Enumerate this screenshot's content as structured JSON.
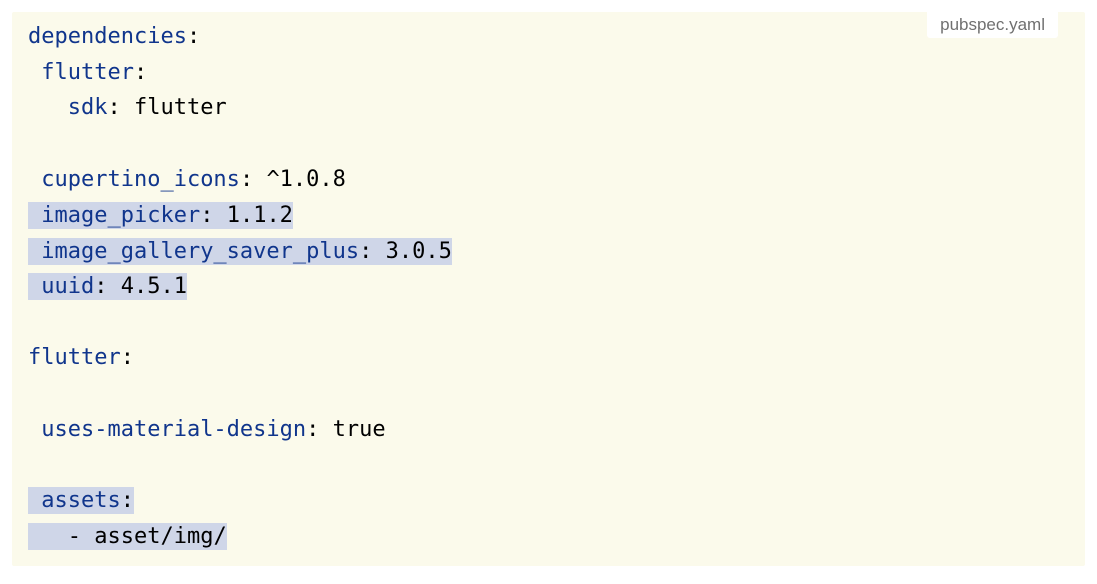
{
  "file_label": "pubspec.yaml",
  "lines": [
    {
      "indent": "",
      "key": "dependencies",
      "sep": ":",
      "value": "",
      "highlight": false
    },
    {
      "indent": " ",
      "key": "flutter",
      "sep": ":",
      "value": "",
      "highlight": false
    },
    {
      "indent": "   ",
      "key": "sdk",
      "sep": ": ",
      "value": "flutter",
      "highlight": false
    },
    {
      "indent": "",
      "key": "",
      "sep": "",
      "value": "",
      "highlight": false
    },
    {
      "indent": " ",
      "key": "cupertino_icons",
      "sep": ": ",
      "value": "^1.0.8",
      "highlight": false
    },
    {
      "indent": " ",
      "key": "image_picker",
      "sep": ": ",
      "value": "1.1.2",
      "highlight": true
    },
    {
      "indent": " ",
      "key": "image_gallery_saver_plus",
      "sep": ": ",
      "value": "3.0.5",
      "highlight": true
    },
    {
      "indent": " ",
      "key": "uuid",
      "sep": ": ",
      "value": "4.5.1",
      "highlight": true
    },
    {
      "indent": "",
      "key": "",
      "sep": "",
      "value": "",
      "highlight": false
    },
    {
      "indent": "",
      "key": "flutter",
      "sep": ":",
      "value": "",
      "highlight": false
    },
    {
      "indent": "",
      "key": "",
      "sep": "",
      "value": "",
      "highlight": false
    },
    {
      "indent": " ",
      "key": "uses-material-design",
      "sep": ": ",
      "value": "true",
      "highlight": false
    },
    {
      "indent": "",
      "key": "",
      "sep": "",
      "value": "",
      "highlight": false
    },
    {
      "indent": " ",
      "key": "assets",
      "sep": ":",
      "value": "",
      "highlight": true
    },
    {
      "indent": "   ",
      "key": "",
      "sep": "",
      "value": "- asset/img/",
      "highlight": true
    }
  ],
  "colors": {
    "panel_background": "#fbfaeb",
    "key_text": "#10358c",
    "value_text": "#000000",
    "highlight": "#cfd6e8"
  }
}
